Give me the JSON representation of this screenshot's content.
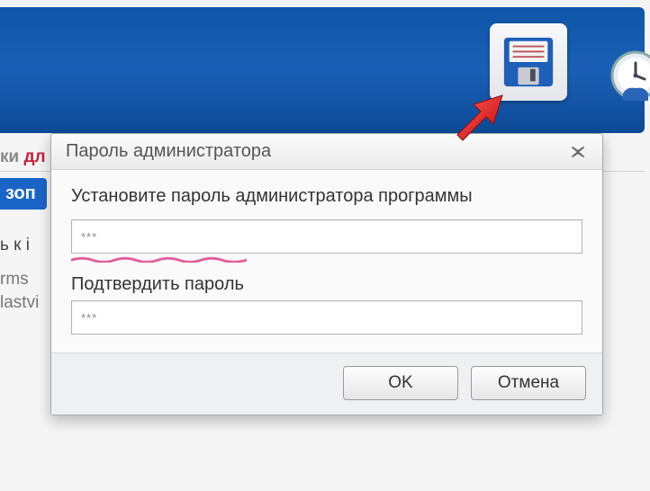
{
  "background": {
    "partial_text_1_gray": "ки ",
    "partial_text_1_red": "дл",
    "blue_badge": "зоп",
    "partial_text_3": "ь к і",
    "partial_text_4": "rms",
    "partial_text_5": "lastvi"
  },
  "toolbar": {
    "save_icon": "floppy-disk-icon",
    "clock_icon": "clock-icon"
  },
  "dialog": {
    "title": "Пароль администратора",
    "label_set_password": "Установите пароль администратора программы",
    "password_value": "***",
    "label_confirm": "Подтвердить пароль",
    "confirm_value": "***",
    "ok_label": "OK",
    "cancel_label": "Отмена"
  }
}
